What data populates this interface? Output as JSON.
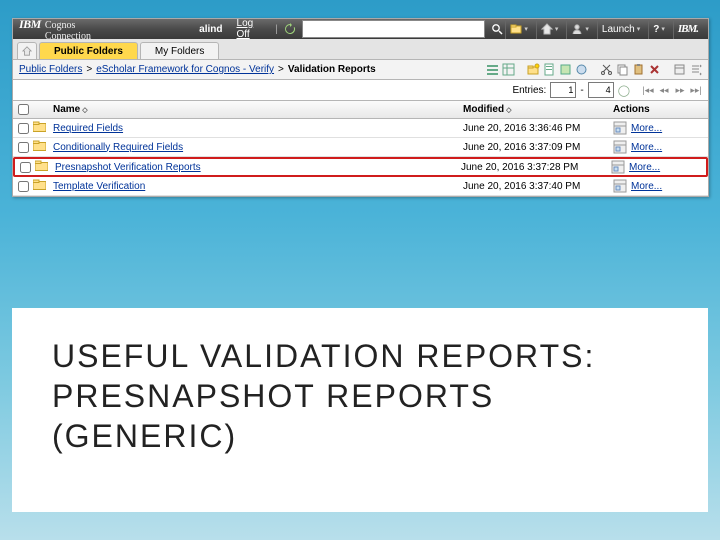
{
  "brand": {
    "ibm": "IBM",
    "product": "Cognos Connection"
  },
  "topbar": {
    "user": "alind",
    "logoff": "Log Off",
    "refresh_icon": "↻",
    "launch": "Launch",
    "ibm_logo": "IBM."
  },
  "tabs": {
    "public": "Public Folders",
    "my": "My Folders"
  },
  "breadcrumb": {
    "a": "Public Folders",
    "b": "eScholar Framework for Cognos - Verify",
    "current": "Validation Reports",
    "sep": ">"
  },
  "entries": {
    "label": "Entries:",
    "from": "1",
    "dash": "-",
    "to": "4",
    "of": ""
  },
  "columns": {
    "name": "Name",
    "modified": "Modified",
    "actions": "Actions"
  },
  "rows": [
    {
      "name": "Required Fields",
      "modified": "June 20, 2016 3:36:46 PM",
      "more": "More...",
      "hl": false
    },
    {
      "name": "Conditionally Required Fields",
      "modified": "June 20, 2016 3:37:09 PM",
      "more": "More...",
      "hl": false
    },
    {
      "name": "Presnapshot Verification Reports",
      "modified": "June 20, 2016 3:37:28 PM",
      "more": "More...",
      "hl": true
    },
    {
      "name": "Template Verification",
      "modified": "June 20, 2016 3:37:40 PM",
      "more": "More...",
      "hl": false
    }
  ],
  "slide_title": {
    "line1": "USEFUL VALIDATION REPORTS:",
    "line2": "PRESNAPSHOT REPORTS",
    "line3": "(GENERIC)"
  }
}
